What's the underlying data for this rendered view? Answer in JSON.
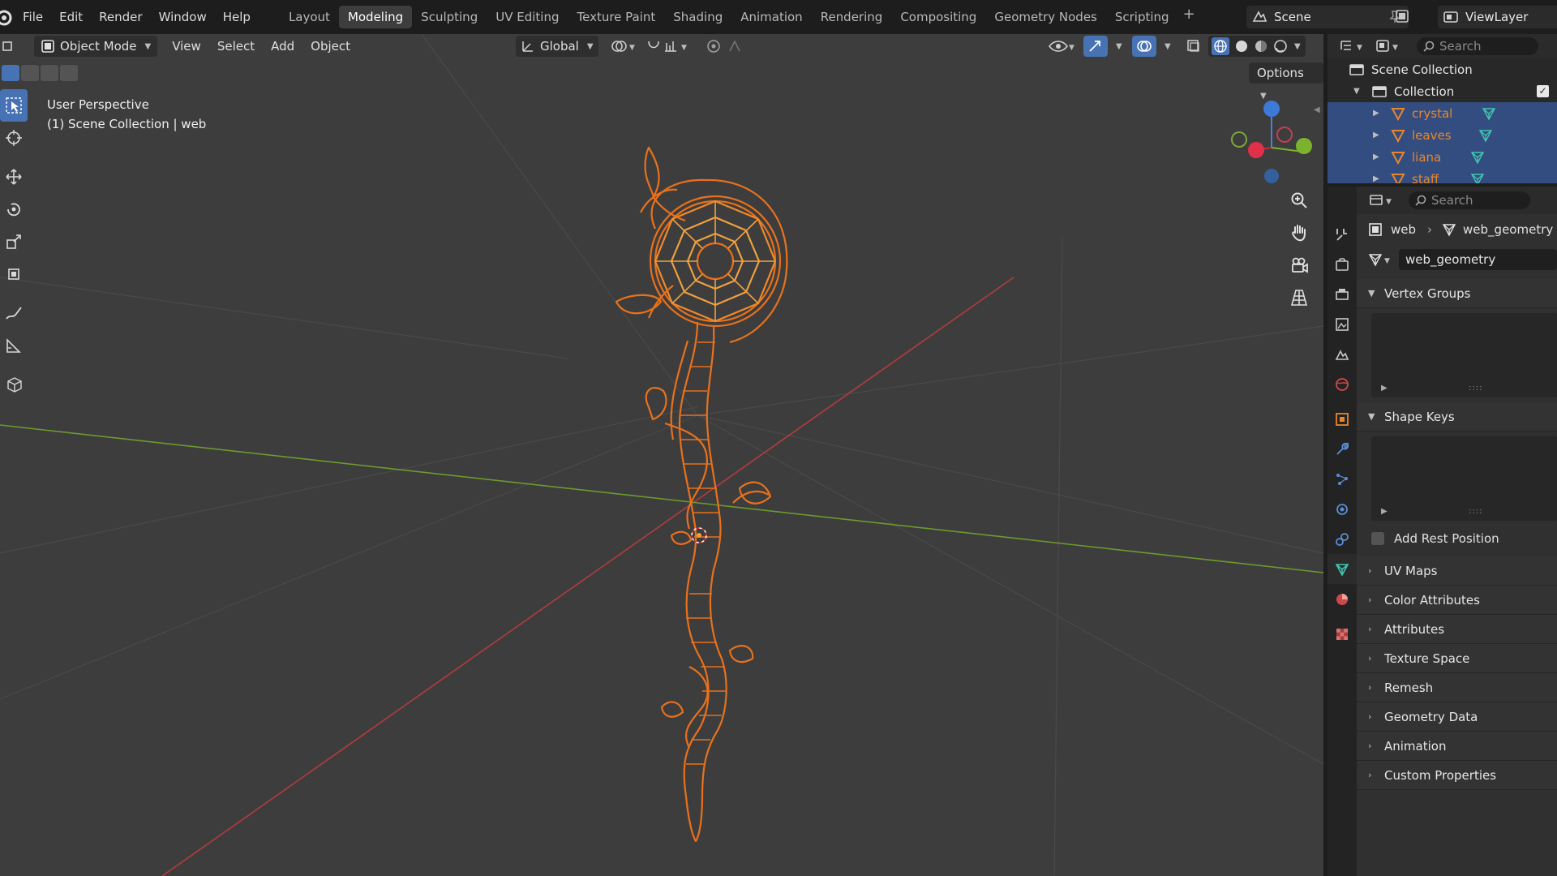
{
  "topbar": {
    "menus": [
      "File",
      "Edit",
      "Render",
      "Window",
      "Help"
    ],
    "workspaces": [
      "Layout",
      "Modeling",
      "Sculpting",
      "UV Editing",
      "Texture Paint",
      "Shading",
      "Animation",
      "Rendering",
      "Compositing",
      "Geometry Nodes",
      "Scripting"
    ],
    "active_workspace": "Modeling",
    "add_workspace": "+",
    "scene_name": "Scene",
    "view_layer": "ViewLayer"
  },
  "viewport": {
    "mode": "Object Mode",
    "menus": [
      "View",
      "Select",
      "Add",
      "Object"
    ],
    "orientation": "Global",
    "options_label": "Options",
    "perspective_label": "User Perspective",
    "collection_label": "(1) Scene Collection | web",
    "gizmo_axes": {
      "x": "X",
      "y": "Y",
      "z": "Z"
    },
    "model_color": "#e8711c",
    "background_color": "#3d3d3d",
    "x_axis_color": "#b43c3c",
    "y_axis_color": "#6c9a2e",
    "tools": [
      "select-box-icon",
      "cursor-icon",
      "move-icon",
      "rotate-icon",
      "scale-icon",
      "transform-icon",
      "annotate-icon",
      "measure-icon",
      "add-cube-icon"
    ],
    "nav_buttons": [
      "zoom-icon",
      "pan-hand-icon",
      "camera-icon",
      "perspective-grid-icon"
    ]
  },
  "outliner": {
    "search_placeholder": "Search",
    "scene_collection": "Scene Collection",
    "collection": "Collection",
    "objects": [
      "crystal",
      "leaves",
      "liana",
      "staff"
    ]
  },
  "properties": {
    "search_placeholder": "Search",
    "breadcrumb_object": "web",
    "breadcrumb_data": "web_geometry",
    "data_name": "web_geometry",
    "panels": {
      "vertex_groups": "Vertex Groups",
      "shape_keys": "Shape Keys",
      "add_rest_position": "Add Rest Position",
      "collapsed": [
        "UV Maps",
        "Color Attributes",
        "Attributes",
        "Texture Space",
        "Remesh",
        "Geometry Data",
        "Animation",
        "Custom Properties"
      ]
    }
  }
}
